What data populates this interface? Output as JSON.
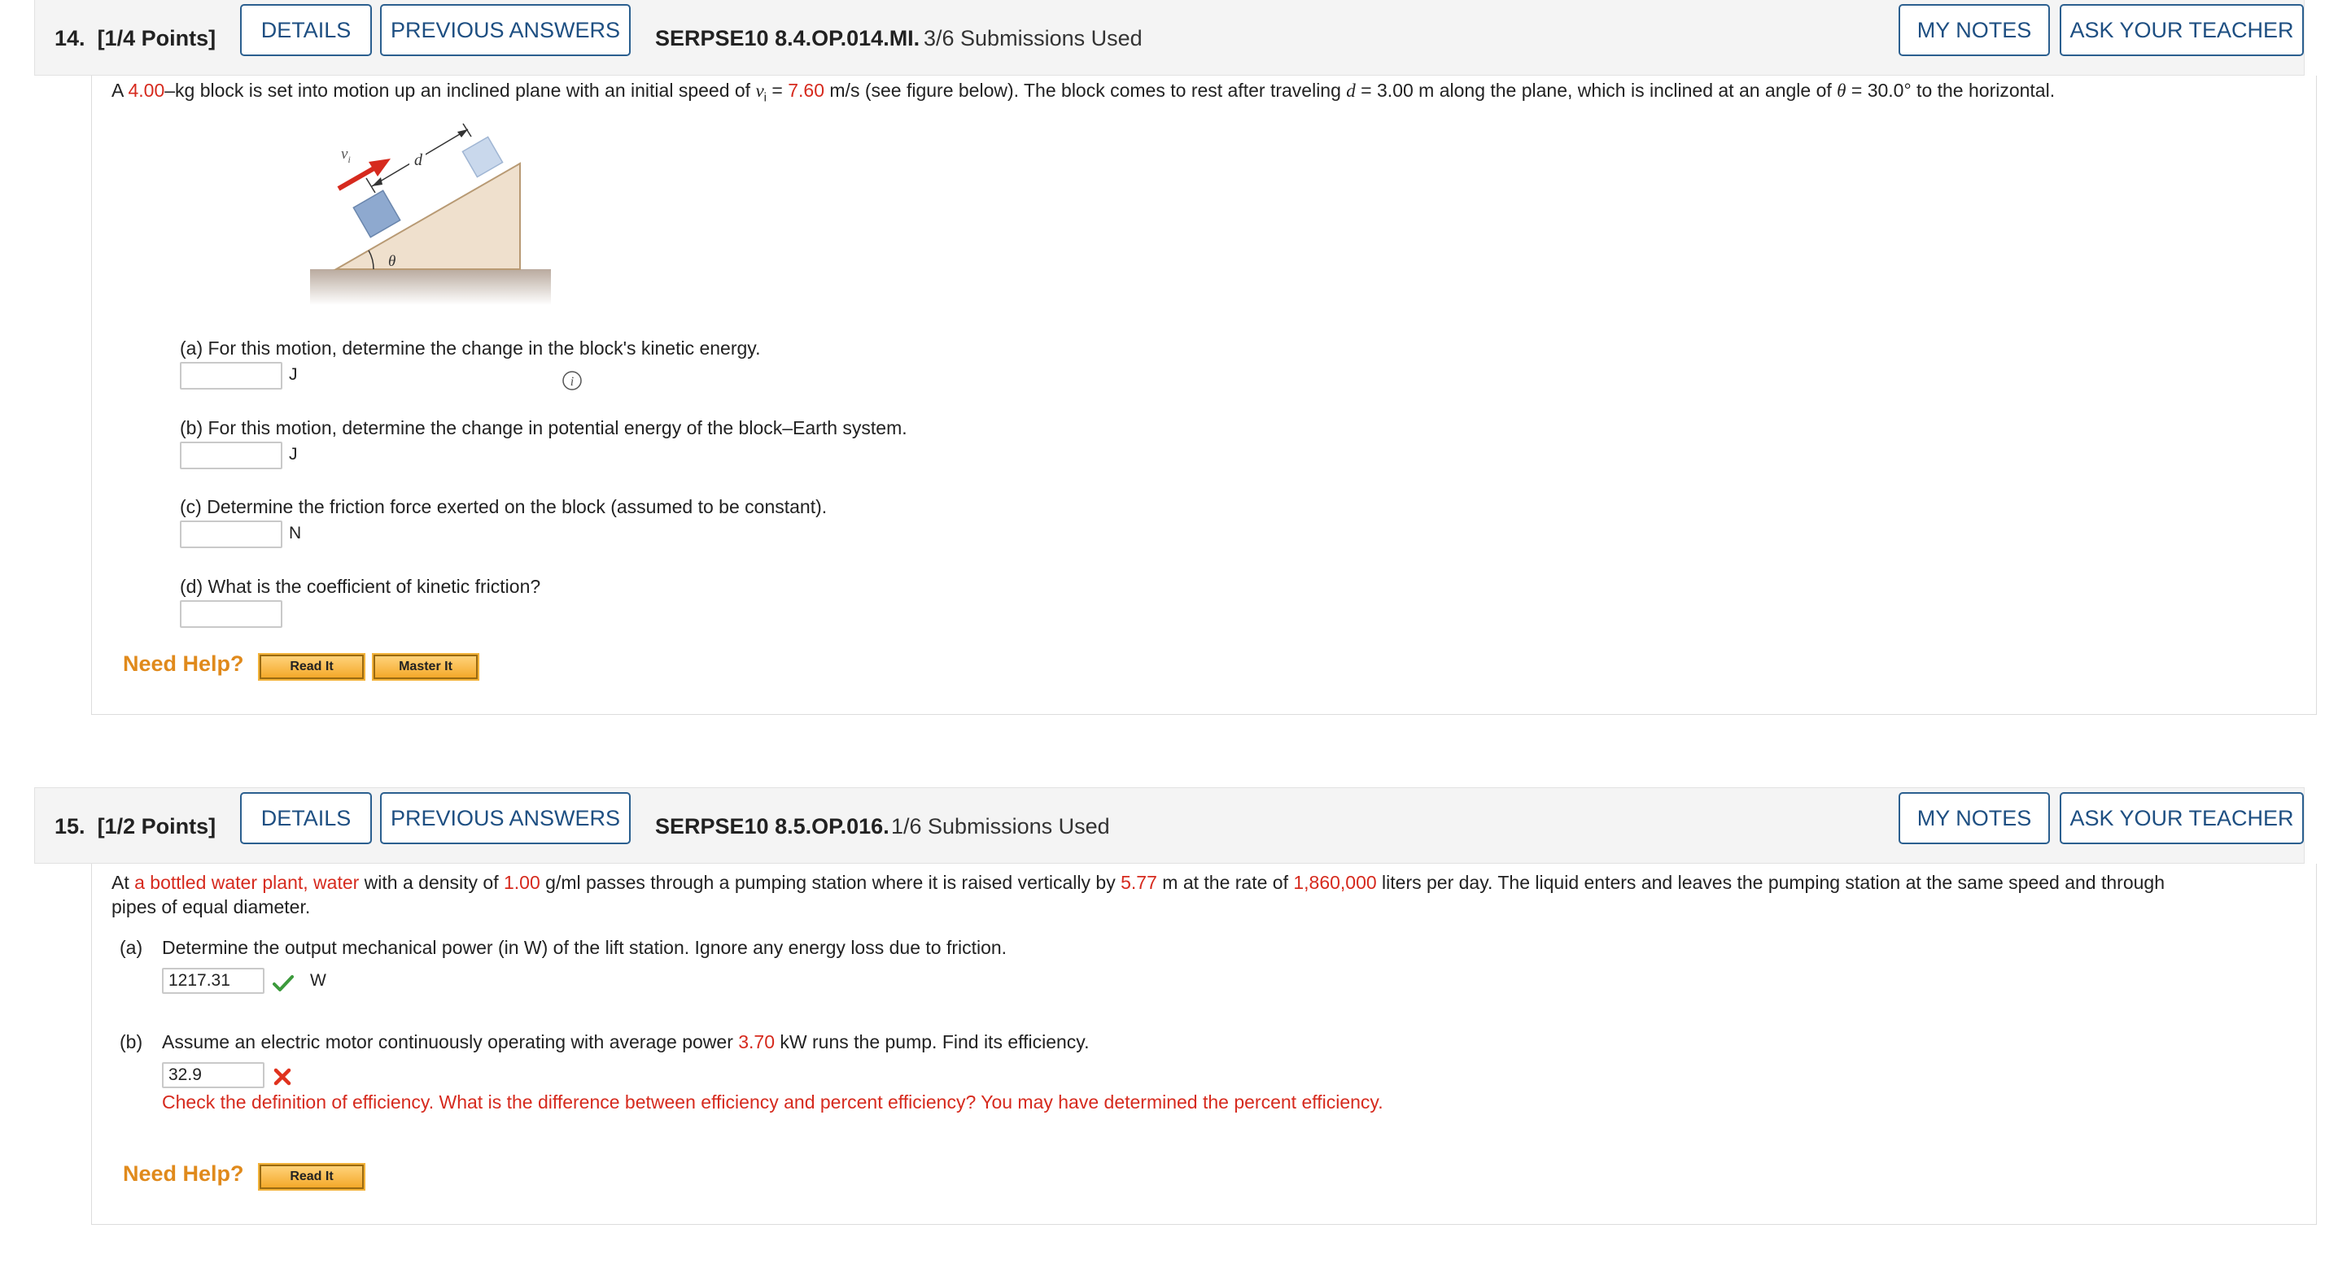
{
  "q14": {
    "number": "14.",
    "points": "[1/4 Points]",
    "details_label": "DETAILS",
    "prev_answers_label": "PREVIOUS ANSWERS",
    "code": "SERPSE10 8.4.OP.014.MI.",
    "submissions": "3/6 Submissions Used",
    "my_notes_label": "MY NOTES",
    "ask_teacher_label": "ASK YOUR TEACHER",
    "problem": {
      "t1": "A ",
      "mass": "4.00",
      "t2": "–kg block is set into motion up an inclined plane with an initial speed of ",
      "v_sym": "v",
      "v_sub": "i",
      "t3": " = ",
      "speed": "7.60",
      "t4": " m/s (see figure below). The block comes to rest after traveling ",
      "d_sym": "d",
      "t5": " = 3.00 m along the plane, which is inclined at an angle of ",
      "theta_sym": "θ",
      "t6": " = 30.0° to the horizontal."
    },
    "figure": {
      "v_label": "v",
      "v_sub": "i",
      "d_label": "d",
      "theta_label": "θ",
      "info_icon": "i"
    },
    "parts": [
      {
        "prompt": "(a) For this motion, determine the change in the block's kinetic energy.",
        "value": "",
        "unit": "J"
      },
      {
        "prompt": "(b) For this motion, determine the change in potential energy of the block–Earth system.",
        "value": "",
        "unit": "J"
      },
      {
        "prompt": "(c) Determine the friction force exerted on the block (assumed to be constant).",
        "value": "",
        "unit": "N"
      },
      {
        "prompt": "(d) What is the coefficient of kinetic friction?",
        "value": "",
        "unit": ""
      }
    ],
    "need_help": "Need Help?",
    "read_it": "Read It",
    "master_it": "Master It"
  },
  "q15": {
    "number": "15.",
    "points": "[1/2 Points]",
    "details_label": "DETAILS",
    "prev_answers_label": "PREVIOUS ANSWERS",
    "code": "SERPSE10 8.5.OP.016.",
    "submissions": "1/6 Submissions Used",
    "my_notes_label": "MY NOTES",
    "ask_teacher_label": "ASK YOUR TEACHER",
    "problem": {
      "t1": "At ",
      "place": "a bottled water plant, water",
      "t2": " with a density of ",
      "density": "1.00",
      "t3": " g/ml passes through a pumping station where it is raised vertically by ",
      "height": "5.77",
      "t4": " m at the rate of ",
      "rate": "1,860,000",
      "t5": " liters per day. The liquid enters and leaves the pumping station at the same speed and through",
      "line2": "pipes of equal diameter."
    },
    "part_a": {
      "label": "(a)",
      "prompt": "Determine the output mechanical power (in W) of the lift station. Ignore any energy loss due to friction.",
      "value": "1217.31",
      "unit": "W",
      "status": "correct"
    },
    "part_b": {
      "label": "(b)",
      "p1": "Assume an electric motor continuously operating with average power ",
      "power": "3.70",
      "p2": " kW runs the pump. Find its efficiency.",
      "value": "32.9",
      "status": "incorrect",
      "feedback": "Check the definition of efficiency. What is the difference between efficiency and percent efficiency? You may have determined the percent efficiency."
    },
    "need_help": "Need Help?",
    "read_it": "Read It"
  },
  "colors": {
    "accent_blue": "#1e4f82",
    "given_red": "#d62a1e",
    "help_orange": "#e08a1c",
    "correct_green": "#3c9a3c",
    "wrong_red": "#e0321e"
  }
}
